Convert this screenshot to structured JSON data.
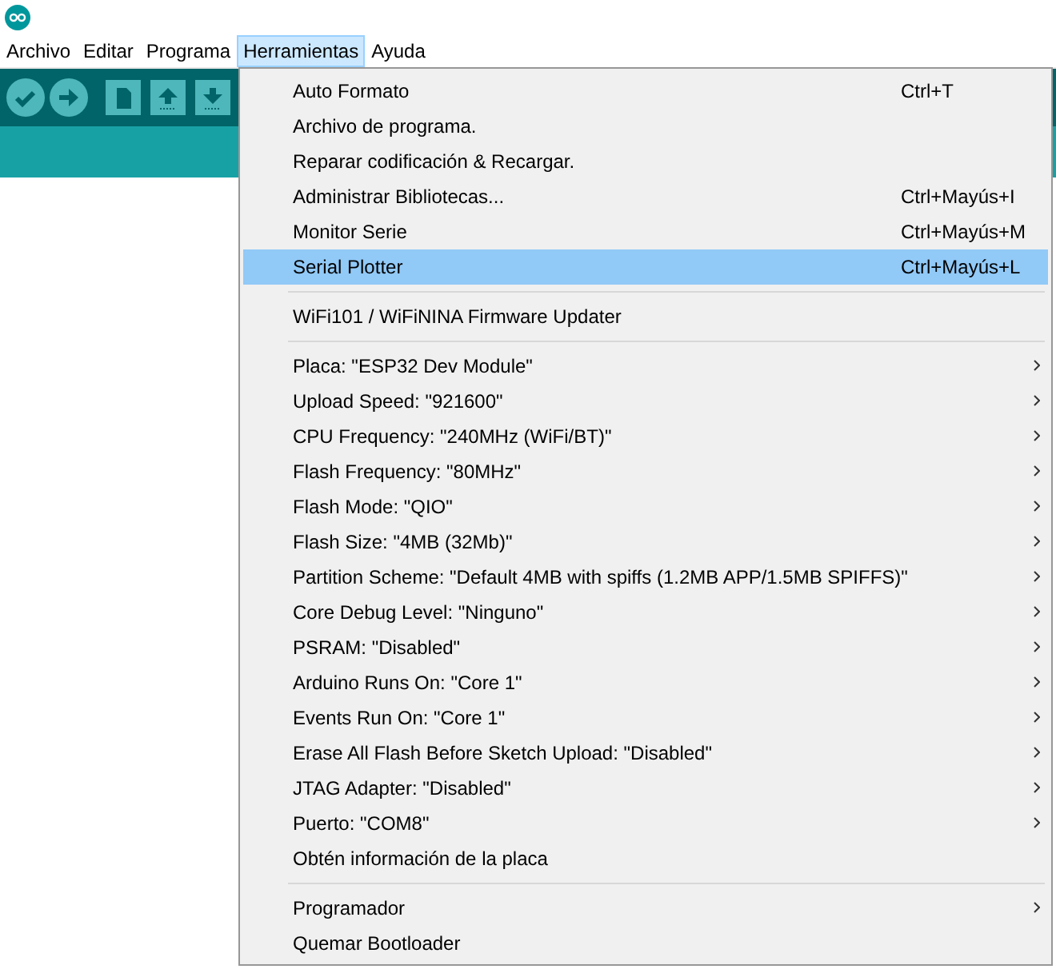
{
  "menubar": [
    {
      "label": "Archivo",
      "selected": false
    },
    {
      "label": "Editar",
      "selected": false
    },
    {
      "label": "Programa",
      "selected": false
    },
    {
      "label": "Herramientas",
      "selected": true
    },
    {
      "label": "Ayuda",
      "selected": false
    }
  ],
  "menu": {
    "sections": [
      [
        {
          "label": "Auto Formato",
          "shortcut": "Ctrl+T",
          "selected": false,
          "submenu": false
        },
        {
          "label": "Archivo de programa.",
          "selected": false,
          "submenu": false
        },
        {
          "label": "Reparar codificación & Recargar.",
          "selected": false,
          "submenu": false
        },
        {
          "label": "Administrar Bibliotecas...",
          "shortcut": "Ctrl+Mayús+I",
          "selected": false,
          "submenu": false
        },
        {
          "label": "Monitor Serie",
          "shortcut": "Ctrl+Mayús+M",
          "selected": false,
          "submenu": false
        },
        {
          "label": "Serial Plotter",
          "shortcut": "Ctrl+Mayús+L",
          "selected": true,
          "submenu": false
        }
      ],
      [
        {
          "label": "WiFi101 / WiFiNINA Firmware Updater",
          "selected": false,
          "submenu": false
        }
      ],
      [
        {
          "label": "Placa: \"ESP32 Dev Module\"",
          "selected": false,
          "submenu": true
        },
        {
          "label": "Upload Speed: \"921600\"",
          "selected": false,
          "submenu": true
        },
        {
          "label": "CPU Frequency: \"240MHz (WiFi/BT)\"",
          "selected": false,
          "submenu": true
        },
        {
          "label": "Flash Frequency: \"80MHz\"",
          "selected": false,
          "submenu": true
        },
        {
          "label": "Flash Mode: \"QIO\"",
          "selected": false,
          "submenu": true
        },
        {
          "label": "Flash Size: \"4MB (32Mb)\"",
          "selected": false,
          "submenu": true
        },
        {
          "label": "Partition Scheme: \"Default 4MB with spiffs (1.2MB APP/1.5MB SPIFFS)\"",
          "selected": false,
          "submenu": true
        },
        {
          "label": "Core Debug Level: \"Ninguno\"",
          "selected": false,
          "submenu": true
        },
        {
          "label": "PSRAM: \"Disabled\"",
          "selected": false,
          "submenu": true
        },
        {
          "label": "Arduino Runs On: \"Core 1\"",
          "selected": false,
          "submenu": true
        },
        {
          "label": "Events Run On: \"Core 1\"",
          "selected": false,
          "submenu": true
        },
        {
          "label": "Erase All Flash Before Sketch Upload: \"Disabled\"",
          "selected": false,
          "submenu": true
        },
        {
          "label": "JTAG Adapter: \"Disabled\"",
          "selected": false,
          "submenu": true
        },
        {
          "label": "Puerto: \"COM8\"",
          "selected": false,
          "submenu": true
        },
        {
          "label": "Obtén información de la placa",
          "selected": false,
          "submenu": false
        }
      ],
      [
        {
          "label": "Programador",
          "selected": false,
          "submenu": true
        },
        {
          "label": "Quemar Bootloader",
          "selected": false,
          "submenu": false
        }
      ]
    ]
  }
}
